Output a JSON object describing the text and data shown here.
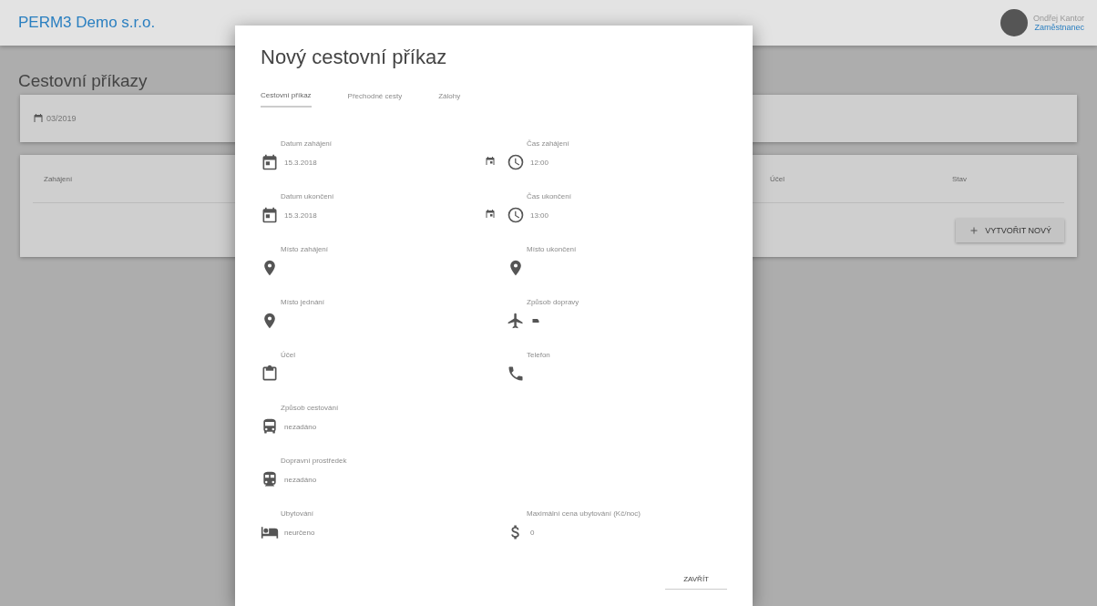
{
  "header": {
    "brand": "PERM3 Demo s.r.o.",
    "user_name": "Ondřej Kantor",
    "user_role": "Zaměstnanec"
  },
  "page": {
    "title": "Cestovní příkazy",
    "filter_date": "03/2019",
    "table": {
      "columns": [
        "Zahájení",
        "Účel",
        "Stav"
      ]
    },
    "create_button": "VYTVOŘIT NOVÝ"
  },
  "dialog": {
    "title": "Nový cestovní příkaz",
    "tabs": [
      {
        "label": "Cestovní příkaz",
        "selected": true
      },
      {
        "label": "Přechodné cesty",
        "selected": false
      },
      {
        "label": "Zálohy",
        "selected": false
      }
    ],
    "rows": [
      {
        "left": {
          "kind": "date",
          "label": "Datum zahájení",
          "value": "15.3.2018"
        },
        "right": {
          "kind": "time",
          "label": "Čas zahájení",
          "value": "12:00"
        }
      },
      {
        "left": {
          "kind": "date",
          "label": "Datum ukončení",
          "value": "15.3.2018"
        },
        "right": {
          "kind": "time",
          "label": "Čas ukončení",
          "value": "13:00"
        }
      },
      {
        "left": {
          "kind": "place",
          "label": "Místo zahájení"
        },
        "right": {
          "kind": "place",
          "label": "Místo ukončení"
        }
      },
      {
        "left": {
          "kind": "place",
          "label": "Místo jednání"
        },
        "right": {
          "kind": "flight",
          "label": "Způsob dopravy"
        }
      },
      {
        "left": {
          "kind": "clipboard",
          "label": "Účel"
        },
        "right": {
          "kind": "phone",
          "label": "Telefon"
        }
      },
      {
        "left": {
          "kind": "bus",
          "label": "Způsob cestování",
          "value": "nezadáno"
        }
      },
      {
        "left": {
          "kind": "train",
          "label": "Dopravní prostředek",
          "value": "nezadáno"
        }
      },
      {
        "left": {
          "kind": "hotel",
          "label": "Ubytování",
          "value": "neurčeno"
        },
        "right": {
          "kind": "money",
          "label": "Maximální cena ubytování (Kč/noc)",
          "value": "0"
        }
      }
    ],
    "close_button": "ZAVŘÍT"
  }
}
